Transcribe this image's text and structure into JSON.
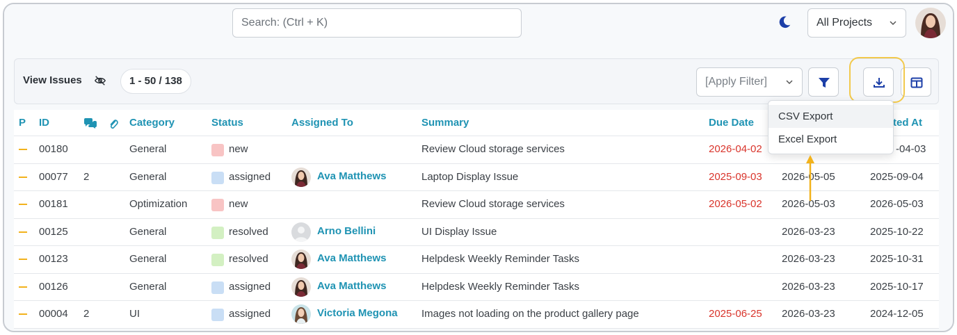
{
  "colors": {
    "accent": "#1f93b3",
    "priority": "#f2b21c",
    "overdue": "#d9342b",
    "highlight": "#f2c94c"
  },
  "topbar": {
    "search_placeholder": "Search: (Ctrl + K)",
    "theme_icon": "moon-icon",
    "project_select": "All Projects"
  },
  "toolbar": {
    "title": "View Issues",
    "count": "1 - 50 / 138",
    "filter_placeholder": "[Apply Filter]",
    "icons": [
      "eye-off-icon",
      "filter-icon",
      "download-icon",
      "columns-icon"
    ]
  },
  "export_menu": {
    "items": [
      "CSV Export",
      "Excel Export"
    ]
  },
  "table": {
    "headers": {
      "p": "P",
      "id": "ID",
      "category": "Category",
      "status": "Status",
      "assigned": "Assigned To",
      "summary": "Summary",
      "due": "Due Date",
      "updated": "ted At"
    },
    "rows": [
      {
        "id": "00180",
        "notes": "",
        "category": "General",
        "status": "new",
        "status_color": "#f8c4c4",
        "assignee": "",
        "summary": "Review Cloud storage services",
        "due": "2026-04-02",
        "created": "",
        "updated": "-04-03"
      },
      {
        "id": "00077",
        "notes": "2",
        "category": "General",
        "status": "assigned",
        "status_color": "#c9def5",
        "assignee": "Ava Matthews",
        "summary": "Laptop Display Issue",
        "due": "2025-09-03",
        "created": "2026-05-05",
        "updated": "2025-09-04"
      },
      {
        "id": "00181",
        "notes": "",
        "category": "Optimization",
        "status": "new",
        "status_color": "#f8c4c4",
        "assignee": "",
        "summary": "Review Cloud storage services",
        "due": "2026-05-02",
        "created": "2026-05-03",
        "updated": "2026-05-03"
      },
      {
        "id": "00125",
        "notes": "",
        "category": "General",
        "status": "resolved",
        "status_color": "#d3f0c2",
        "assignee": "Arno Bellini",
        "summary": "UI Display Issue",
        "due": "",
        "created": "2026-03-23",
        "updated": "2025-10-22"
      },
      {
        "id": "00123",
        "notes": "",
        "category": "General",
        "status": "resolved",
        "status_color": "#d3f0c2",
        "assignee": "Ava Matthews",
        "summary": "Helpdesk Weekly Reminder Tasks",
        "due": "",
        "created": "2026-03-23",
        "updated": "2025-10-31"
      },
      {
        "id": "00126",
        "notes": "",
        "category": "General",
        "status": "assigned",
        "status_color": "#c9def5",
        "assignee": "Ava Matthews",
        "summary": "Helpdesk Weekly Reminder Tasks",
        "due": "",
        "created": "2026-03-23",
        "updated": "2025-10-17"
      },
      {
        "id": "00004",
        "notes": "2",
        "category": "UI",
        "status": "assigned",
        "status_color": "#c9def5",
        "assignee": "Victoria Megona",
        "summary": "Images not loading on the product gallery page",
        "due": "2025-06-25",
        "created": "2026-03-23",
        "updated": "2024-12-05"
      }
    ]
  }
}
